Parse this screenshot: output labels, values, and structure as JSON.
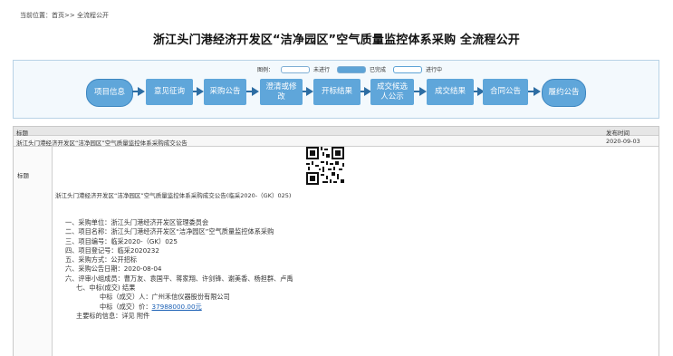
{
  "breadcrumb": {
    "prefix": "当前位置：",
    "home": "首页",
    "sep": ">>",
    "current": "全流程公开"
  },
  "title": "浙江头门港经济开发区“洁净园区”空气质量监控体系采购 全流程公开",
  "legend": {
    "label": "图例：",
    "todo": "未进行",
    "done": "已完成",
    "doing": "进行中"
  },
  "steps": [
    "项目信息",
    "意见征询",
    "采购公告",
    "澄清或修改",
    "开标结果",
    "成交候选人公示",
    "成交结果",
    "合同公告",
    "履约公告"
  ],
  "steps_display": {
    "s3": "澄清或修\n改",
    "s5": "成交候选\n人公示"
  },
  "table": {
    "col_title": "标题",
    "col_date": "发布时间",
    "row_title": "浙江头门港经济开发区“洁净园区”空气质量监控体系采购成交公告",
    "row_date": "2020-09-03",
    "label": "标题"
  },
  "announcement": {
    "heading": "浙江头门港经济开发区“洁净园区”空气质量监控体系采购成交公告(临采2020-（GK）025)",
    "items": [
      "一、采购单位：浙江头门港经济开发区管理委员会",
      "二、项目名称：浙江头门港经济开发区“洁净园区”空气质量监控体系采购",
      "三、项目编号：临采2020-（GK）025",
      "四、项目登记号：临采2020232",
      "五、采购方式：公开招标",
      "六、采购公告日期：2020-08-04",
      "六、评审小组成员：曹万友、袁国平、蒋家翔、许剑锋、谢美香、杨担群、卢禹",
      "七、中标(成交) 结果"
    ],
    "winner_label": "中标（成交）人：",
    "winner": "广州禾信仪器股份有限公司",
    "price_label": "中标（成交）价：",
    "price": "37988000.00元",
    "detail_label": "主要标的信息：",
    "detail": "详见 附件"
  },
  "colors": {
    "step": "#5fa6da",
    "arrow": "#2d6da3",
    "link": "#1a5fb4"
  }
}
